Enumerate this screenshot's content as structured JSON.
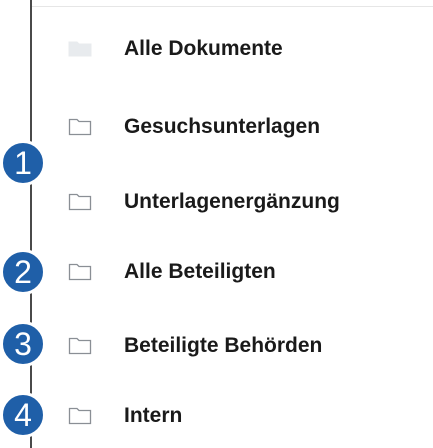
{
  "folders": [
    {
      "label": "Alle Dokumente",
      "icon": "folder-filled-icon"
    },
    {
      "label": "Gesuchsunterlagen",
      "icon": "folder-icon"
    },
    {
      "label": "Unterlagenergänzung",
      "icon": "folder-icon"
    },
    {
      "label": "Alle Beteiligten",
      "icon": "folder-icon"
    },
    {
      "label": "Beteiligte Behörden",
      "icon": "folder-icon"
    },
    {
      "label": "Intern",
      "icon": "folder-icon"
    }
  ],
  "callouts": [
    "1",
    "2",
    "3",
    "4"
  ],
  "colors": {
    "badge": "#1f5fa8",
    "folder_fill": "#e8ebee",
    "folder_outline": "#8a8f95",
    "text": "#1a1a1a"
  }
}
